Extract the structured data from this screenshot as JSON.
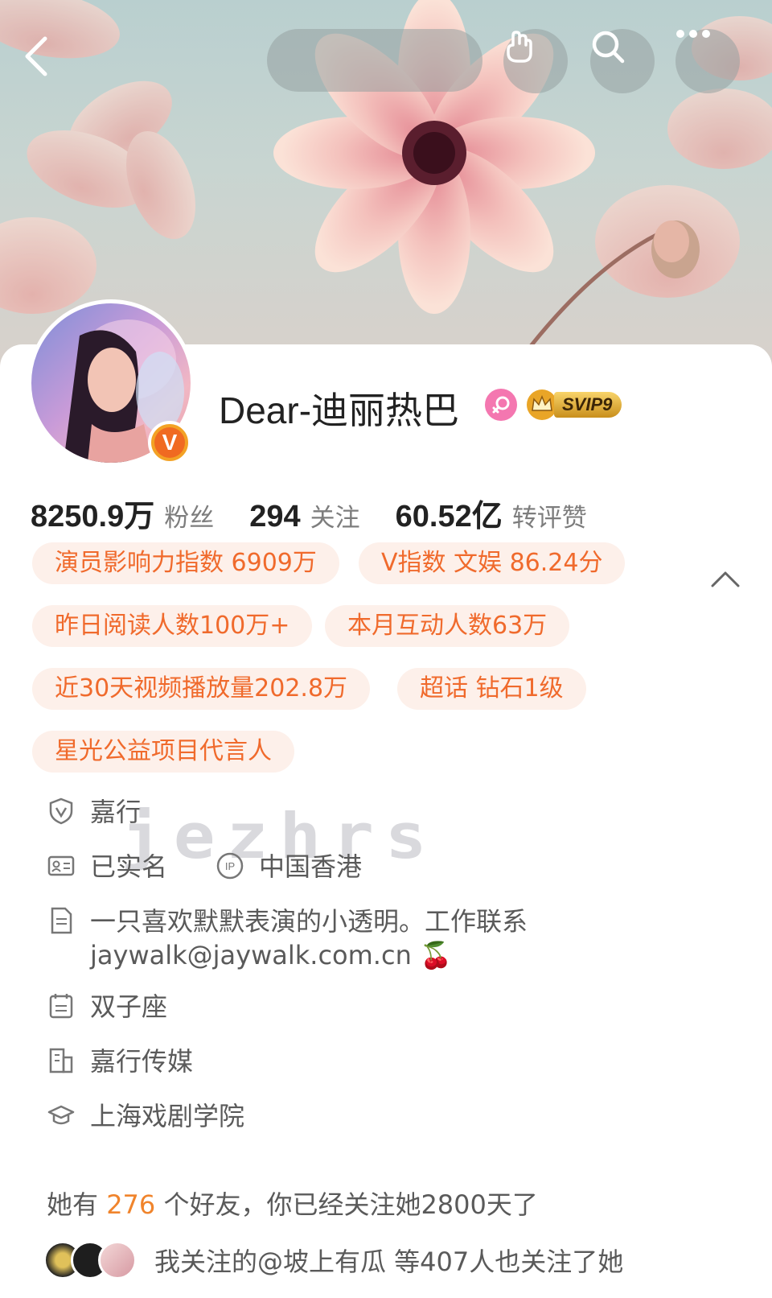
{
  "profile": {
    "name": "Dear-迪丽热巴",
    "svip_label": "SVIP9"
  },
  "stats": [
    {
      "value": "8250.9万",
      "label": "粉丝"
    },
    {
      "value": "294",
      "label": "关注"
    },
    {
      "value": "60.52亿",
      "label": "转评赞"
    }
  ],
  "tags": [
    "演员影响力指数 6909万",
    "V指数 文娱 86.24分",
    "昨日阅读人数100万+",
    "本月互动人数63万",
    "近30天视频播放量202.8万",
    "超话 钻石1级",
    "星光公益项目代言人"
  ],
  "info": {
    "verification": "嘉行",
    "real_name": "已实名",
    "ip_location": "中国香港",
    "bio_line1": "一只喜欢默默表演的小透明。工作联系",
    "bio_line2": "jaywalk@jaywalk.com.cn 🍒",
    "zodiac": "双子座",
    "company": "嘉行传媒",
    "school": "上海戏剧学院"
  },
  "friends": {
    "prefix": "她有",
    "count": "276",
    "suffix": "个好友，你已经关注她2800天了"
  },
  "mutual": {
    "text": "我关注的@坡上有瓜 等407人也关注了她"
  },
  "watermark": "jezhrs",
  "colors": {
    "accent": "#f06a2c",
    "tag_bg": "#fdf0ea",
    "verified_orange": "#f3a225",
    "highlight": "#f0842c"
  }
}
